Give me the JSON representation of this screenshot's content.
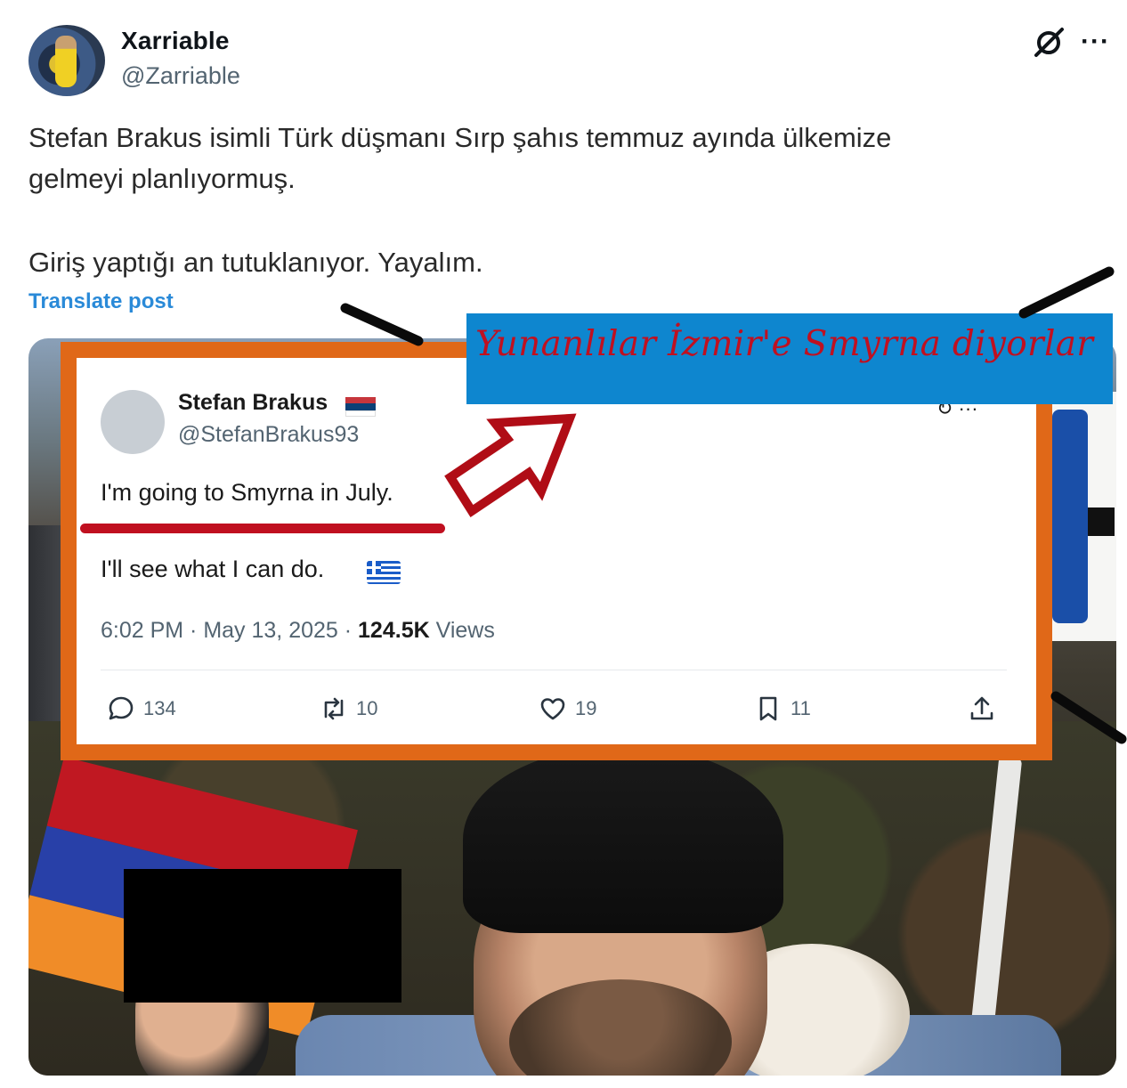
{
  "post": {
    "display_name": "Xarriable",
    "handle": "@Zarriable",
    "text_line_1": "Stefan Brakus isimli Türk düşmanı Sırp şahıs temmuz ayında ülkemize",
    "text_line_2": "gelmeyi planlıyormuş.",
    "text_line_3": "Giriş yaptığı an tutuklanıyor. Yayalım.",
    "translate_label": "Translate post",
    "more_label": "···"
  },
  "annotation": {
    "label": "Yunanlılar İzmir'e Smyrna diyorlar",
    "label_bg": "#0e86cf",
    "label_color": "#c01020",
    "frame_color": "#e06818"
  },
  "embedded_tweet": {
    "display_name": "Stefan Brakus",
    "handle": "@StefanBrakus93",
    "text_1": "I'm going to Smyrna in July.",
    "text_2": "I'll see what I can do.",
    "time": "6:02 PM · May 13, 2025 · ",
    "views_count": "124.5K",
    "views_label": " Views",
    "replies": "134",
    "reposts": "10",
    "likes": "19",
    "bookmarks": "11"
  }
}
